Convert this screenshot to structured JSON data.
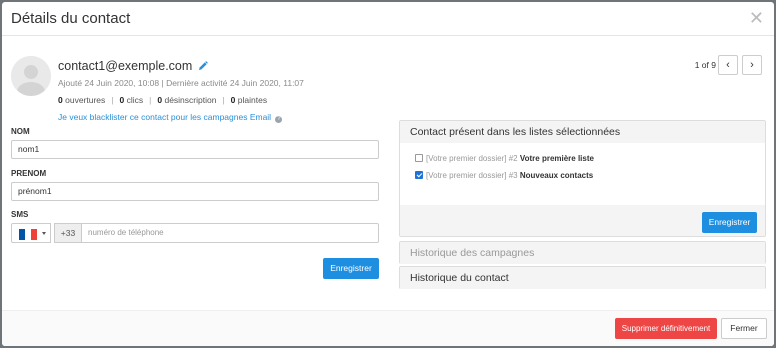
{
  "modal": {
    "title": "Détails du contact",
    "close_glyph": "✕"
  },
  "contact": {
    "email": "contact1@exemple.com",
    "meta": "Ajouté 24 Juin 2020, 10:08 | Dernière activité 24 Juin 2020, 11:07",
    "stats": [
      {
        "count": "0",
        "label": "ouvertures"
      },
      {
        "count": "0",
        "label": "clics"
      },
      {
        "count": "0",
        "label": "désinscription"
      },
      {
        "count": "0",
        "label": "plaintes"
      }
    ],
    "blacklist_link": "Je veux blacklister ce contact pour les campagnes Email",
    "help_glyph": "?"
  },
  "pager": {
    "text": "1 of 9",
    "prev_glyph": "‹",
    "next_glyph": "›"
  },
  "form": {
    "nom_label": "NOM",
    "nom_value": "nom1",
    "prenom_label": "PRENOM",
    "prenom_value": "prénom1",
    "sms_label": "SMS",
    "dial_code": "+33",
    "phone_placeholder": "numéro de téléphone",
    "save_label": "Enregistrer"
  },
  "lists_panel": {
    "title": "Contact présent dans les listes sélectionnées",
    "items": [
      {
        "folder": "[Votre premier dossier]",
        "num": "#2",
        "name": "Votre première liste",
        "checked": false
      },
      {
        "folder": "[Votre premier dossier]",
        "num": "#3",
        "name": "Nouveaux contacts",
        "checked": true
      }
    ],
    "save_label": "Enregistrer"
  },
  "sections": {
    "campaigns": "Historique des campagnes",
    "history": "Historique du contact"
  },
  "footer": {
    "delete_label": "Supprimer définitivement",
    "close_label": "Fermer"
  },
  "colors": {
    "primary": "#1e8ee0",
    "danger": "#ee4545",
    "link": "#2a8fd6",
    "flag": [
      "#0055a4",
      "#ffffff",
      "#ef4135"
    ]
  },
  "icons": {
    "avatar": "default-user-icon",
    "edit": "pencil-icon",
    "help": "question-circle-icon",
    "flag": "france-flag-icon"
  }
}
